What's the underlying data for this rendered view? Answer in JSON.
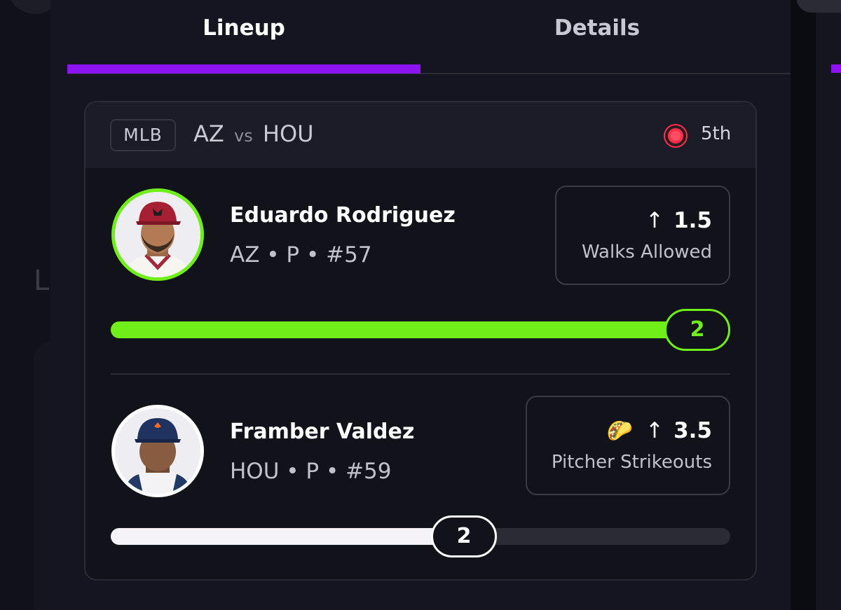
{
  "tabs": [
    {
      "label": "Lineup",
      "active": true
    },
    {
      "label": "Details",
      "active": false
    }
  ],
  "game": {
    "league": "MLB",
    "away": "AZ",
    "vs": "vs",
    "home": "HOU",
    "inning": "5th",
    "live_color": "#ff2f4a"
  },
  "players": [
    {
      "name": "Eduardo Rodriguez",
      "meta": "AZ • P • #57",
      "prop_direction_icon": "arrow-up-icon",
      "prop_line": "1.5",
      "prop_stat": "Walks Allowed",
      "current": "2",
      "progress": 0.95,
      "status_color": "#6fee1a"
    },
    {
      "name": "Framber Valdez",
      "meta": "HOU • P • #59",
      "prop_badge_icon": "taco-icon",
      "prop_direction_icon": "arrow-up-icon",
      "prop_line": "3.5",
      "prop_stat": "Pitcher Strikeouts",
      "current": "2",
      "progress": 0.57,
      "status_color": "#ffffff"
    }
  ],
  "colors": {
    "accent": "#8b14f0",
    "hit": "#6fee1a",
    "background": "#141520",
    "card": "#11121a"
  }
}
